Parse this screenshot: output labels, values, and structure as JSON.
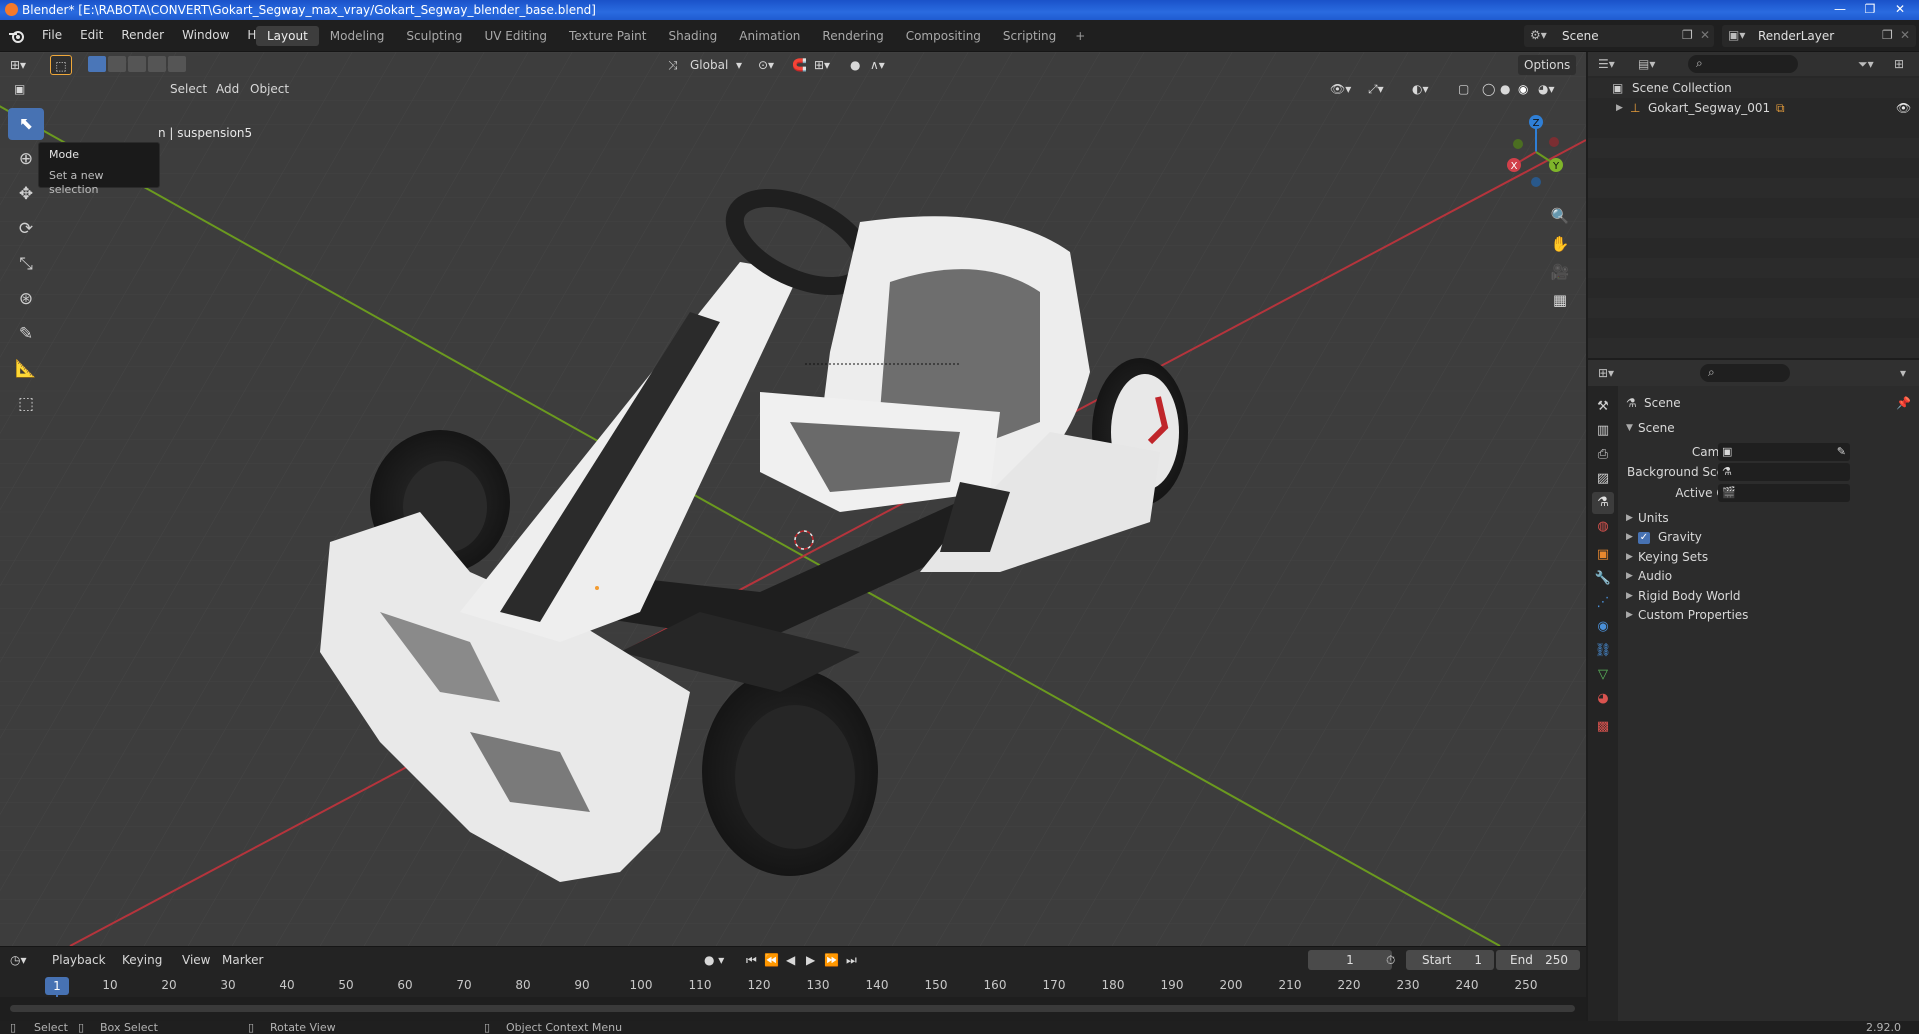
{
  "window": {
    "title": "Blender* [E:\\RABOTA\\CONVERT\\Gokart_Segway_max_vray/Gokart_Segway_blender_base.blend]",
    "controls": [
      "—",
      "❐",
      "✕"
    ]
  },
  "menu": [
    "File",
    "Edit",
    "Render",
    "Window",
    "Help"
  ],
  "workspaces": [
    {
      "label": "Layout",
      "active": true
    },
    {
      "label": "Modeling"
    },
    {
      "label": "Sculpting"
    },
    {
      "label": "UV Editing"
    },
    {
      "label": "Texture Paint"
    },
    {
      "label": "Shading"
    },
    {
      "label": "Animation"
    },
    {
      "label": "Rendering"
    },
    {
      "label": "Compositing"
    },
    {
      "label": "Scripting"
    }
  ],
  "scene_selector": "Scene",
  "renderlayer_selector": "RenderLayer",
  "viewport": {
    "transform_orientation": "Global",
    "options_label": "Options",
    "header_menu": [
      "Select",
      "Add",
      "Object"
    ],
    "tooltip": {
      "title": "Mode",
      "description": "Set a new selection"
    },
    "object_info": "n | suspension5",
    "gizmo_axes": {
      "x": "X",
      "y": "Y",
      "z": "Z"
    }
  },
  "timeline": {
    "menu": [
      "Playback",
      "Keying",
      "View",
      "Marker"
    ],
    "current_frame": "1",
    "start_label": "Start",
    "start_value": "1",
    "end_label": "End",
    "end_value": "250",
    "ticks": [
      "1",
      "10",
      "20",
      "30",
      "40",
      "50",
      "60",
      "70",
      "80",
      "90",
      "100",
      "110",
      "120",
      "130",
      "140",
      "150",
      "160",
      "170",
      "180",
      "190",
      "200",
      "210",
      "220",
      "230",
      "240",
      "250"
    ]
  },
  "statusbar": {
    "select": "Select",
    "box_select": "Box Select",
    "rotate_view": "Rotate View",
    "context_menu": "Object Context Menu",
    "version": "2.92.0"
  },
  "outliner": {
    "root": "Scene Collection",
    "items": [
      {
        "label": "Gokart_Segway_001"
      }
    ]
  },
  "properties": {
    "context": "Scene",
    "panel_title": "Scene",
    "fields": [
      {
        "label": "Camera"
      },
      {
        "label": "Background Scene"
      },
      {
        "label": "Active Clip"
      }
    ],
    "sections": [
      {
        "label": "Units",
        "checkbox": false
      },
      {
        "label": "Gravity",
        "checkbox": true
      },
      {
        "label": "Keying Sets",
        "checkbox": false
      },
      {
        "label": "Audio",
        "checkbox": false
      },
      {
        "label": "Rigid Body World",
        "checkbox": false
      },
      {
        "label": "Custom Properties",
        "checkbox": false
      }
    ]
  },
  "colors": {
    "accent": "#4772b3",
    "x_axis": "#b5343c",
    "y_axis": "#6b9a1f",
    "z_axis": "#2f7fd6",
    "titlebar": "#1f5bd0"
  }
}
